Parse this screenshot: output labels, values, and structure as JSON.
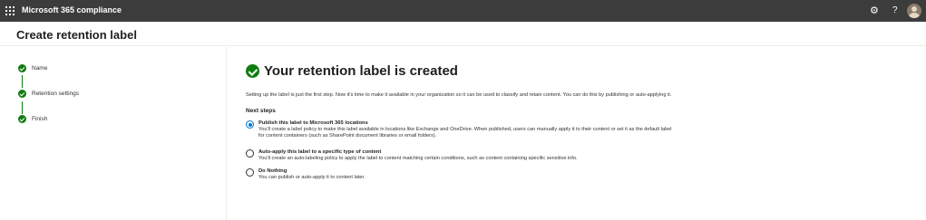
{
  "topbar": {
    "app_title": "Microsoft 365 compliance",
    "icons": [
      "waffle-icon",
      "gear-icon",
      "help-icon",
      "avatar"
    ],
    "help_glyph": "?",
    "gear_glyph": "⚙",
    "background": "#3c3c3c"
  },
  "page": {
    "title": "Create retention label"
  },
  "steps": {
    "items": [
      {
        "label": "Name",
        "status": "complete"
      },
      {
        "label": "Retention settings",
        "status": "complete"
      },
      {
        "label": "Finish",
        "status": "complete"
      }
    ],
    "color": "#107c10"
  },
  "main": {
    "heading": "Your retention label is created",
    "intro": "Setting up the label is just the first step. Now it's time to make it available in your organization so it can be used to classify and retain content. You can do this by publishing or auto-applying it.",
    "next_steps_label": "Next steps",
    "options": [
      {
        "title": "Publish this label to Microsoft 365 locations",
        "description": "You'll create a label policy to make this label available in locations like Exchange and OneDrive. When published, users can manually apply it to their content or set it as the default label for content containers (such as SharePoint document libraries or email folders).",
        "selected": true
      },
      {
        "title": "Auto-apply this label to a specific type of content",
        "description": "You'll create an auto-labeling policy to apply the label to content matching certain conditions, such as content containing specific sensitive info.",
        "selected": false
      },
      {
        "title": "Do Nothing",
        "description": "You can publish or auto-apply it to content later.",
        "selected": false
      }
    ],
    "accent": "#0078d4"
  }
}
